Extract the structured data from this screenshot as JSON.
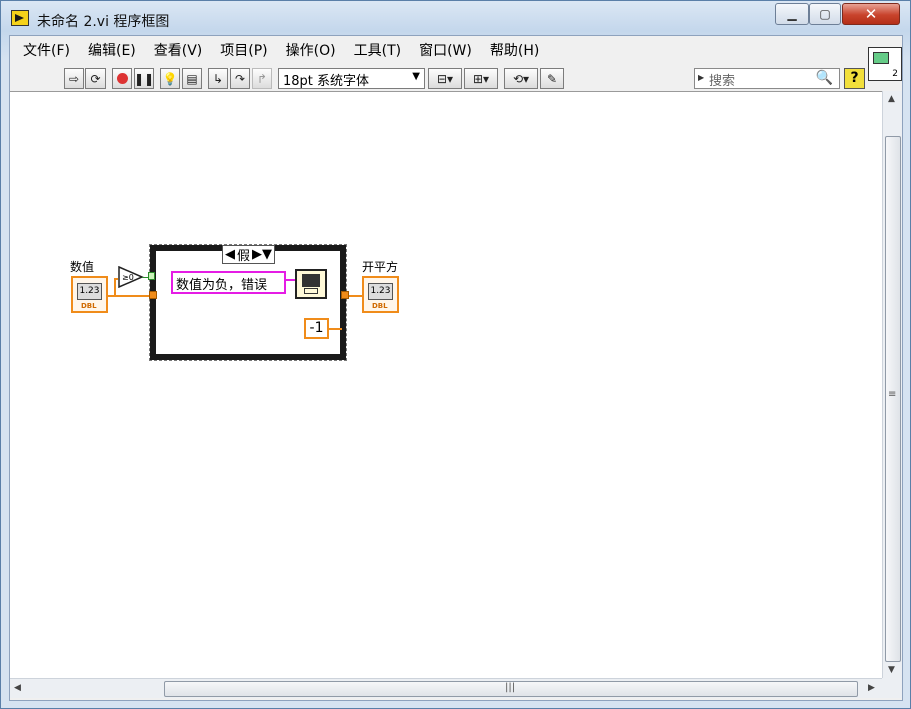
{
  "window": {
    "title": "未命名 2.vi 程序框图"
  },
  "menu": [
    "文件(F)",
    "编辑(E)",
    "查看(V)",
    "项目(P)",
    "操作(O)",
    "工具(T)",
    "窗口(W)",
    "帮助(H)"
  ],
  "toolbar": {
    "font": "18pt 系统字体",
    "search_placeholder": "搜索",
    "help": "?"
  },
  "vi_icon_number": "2",
  "diagram": {
    "input_label": "数值",
    "input_value": "1.23",
    "input_type": "DBL",
    "case_selector": "假",
    "error_string": "数值为负，错误",
    "constant": "-1",
    "output_label": "开平方",
    "output_value": "1.23",
    "output_type": "DBL"
  },
  "colors": {
    "numeric_wire": "#f08c1a",
    "string_wire": "#e51ce5",
    "boolean_wire": "#2a8a2a"
  }
}
